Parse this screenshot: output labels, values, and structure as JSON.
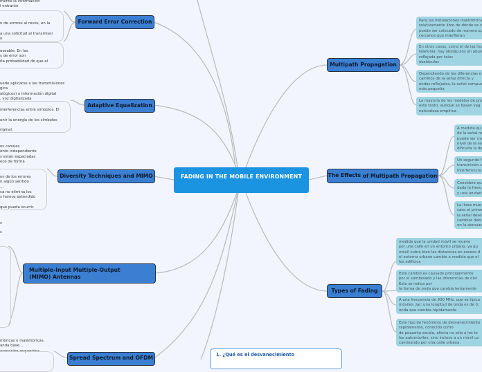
{
  "central": {
    "title": "FADING IN THE MOBILE ENVIRONMENT"
  },
  "left_topics": [
    {
      "label": "Forward Error Correction",
      "snippets": [
        "mente la información\nl entrante",
        "n de errores al revés, en la\n\na una solicitud al transmisor\no",
        "eseable. En las\ns de error son\nita probabilidad de que el"
      ]
    },
    {
      "label": "Adaptive Equalization",
      "snippets": [
        "uede aplicarse a las transmisiones\ngica\nalógicos) o información digital\n, voz digitalizada",
        "nterferencias entre símbolos. El\n\nunir la energía de los símbolos\n\nriginal."
      ]
    },
    {
      "label": "Diversity Techniques and MIMO",
      "snippets": [
        "os canales\nento independiente\ns están espaciadas\nece de forma",
        "os de los errores\nn algún sentido\n...\nca no elimina los\ns hemos extendido\n\nque pueda ocurrir."
      ]
    },
    {
      "label": "Multiple-Input Multiple-Output (MIMO) Antennas",
      "snippets": [
        "s",
        "s"
      ]
    },
    {
      "label": "Spread Spectrum and OFDM",
      "snippets": [
        "mbricas o inalámbricas,\nanda base...\naramisión requeridos."
      ]
    }
  ],
  "right_topics": [
    {
      "label": "Multipath Propagation",
      "notes": [
        "Para las instalaciones inalámbricas\nrelativamente libre de dónde se v\npuede ser colocado de manera qu\ncercanos que interfieran",
        "En otros casos, como el de las ins\ntelefonía, hay obstáculos en abun\nreflejada por tales\nobstáculos",
        "Dependiendo de las diferencias e\ncaminos de la señal directa y\nondas reflejadas, la señal compue\nmás pequeña",
        "La mayoría de los modelos de pro\neste texto, aunque se basan vag\nnaturaleza empírica"
      ]
    },
    {
      "label_part1": "The Effects",
      "label_part2": " of Multipath Propagation",
      "notes": [
        "A medida qu\nde la señal re\npuede ser me\nnivel de la se\ndificulta la de",
        "Un segundo f\ntransmisión c\ninterferencia",
        "Considere qu\ndada la frecu\ny una unidad",
        "La línea mue\ncaso el prime\n la señal dese\ncambiar debi\nen la atenuac"
      ]
    },
    {
      "label": "Types of Fading",
      "notes": [
        "medida que la unidad móvil se mueve\n por una calle en un entorno urbano, ya qu\nmóvil cubre bien las distancias en exceso d\nel entorno urbano cambia a medida que el\nlos edificios",
        "Este cambio es causado principalmente\n por el sombreado y las diferencias de dist\nEsto se indica por\nla forma de onda que cambia lentamente",
        "A una frecuencia de 900 MHz, que es típica\nmóviles..Jar; una longitud de onda es de 0,\nonda que cambia rápidamente",
        "Este tipo de fenómeno de desvanecimiento\nrápidamente, conocido como\n de pequeña escala, afecta no sólo a los te\nlos automóviles, sino incluso a un móvil us\ncaminando por una calle urbana."
      ]
    }
  ],
  "info_card": {
    "title": "1. ¿Qué es el desvanecimiento"
  }
}
